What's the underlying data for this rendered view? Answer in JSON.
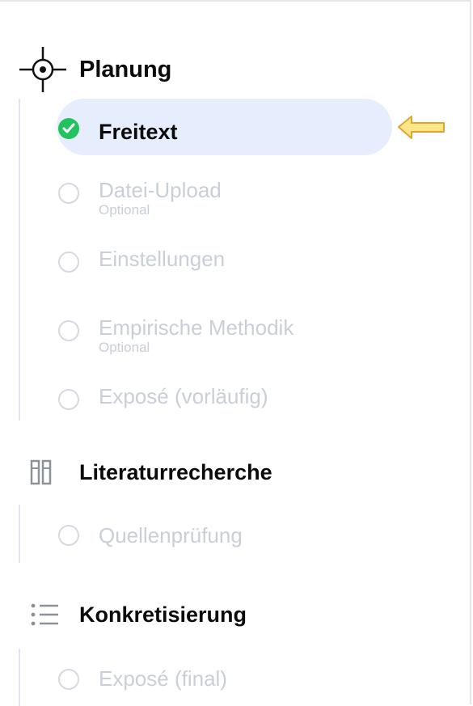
{
  "sections": [
    {
      "title": "Planung",
      "icon": "crosshair-icon",
      "steps": [
        {
          "label": "Freitext",
          "sub": "",
          "state": "active"
        },
        {
          "label": "Datei-Upload",
          "sub": "Optional",
          "state": "pending"
        },
        {
          "label": "Einstellungen",
          "sub": "",
          "state": "pending"
        },
        {
          "label": "Empirische Methodik",
          "sub": "Optional",
          "state": "pending"
        },
        {
          "label": "Exposé (vorläufig)",
          "sub": "",
          "state": "pending"
        }
      ]
    },
    {
      "title": "Literaturrecherche",
      "icon": "book-columns-icon",
      "steps": [
        {
          "label": "Quellenprüfung",
          "sub": "",
          "state": "pending"
        }
      ]
    },
    {
      "title": "Konkretisierung",
      "icon": "list-icon",
      "steps": [
        {
          "label": "Exposé (final)",
          "sub": "",
          "state": "pending"
        }
      ]
    }
  ],
  "colors": {
    "active_bg": "#e6edfd",
    "check_green": "#22c35e",
    "muted_text": "#c9cfd9",
    "arrow_fill": "#fde68a",
    "arrow_stroke": "#e2a52b"
  }
}
